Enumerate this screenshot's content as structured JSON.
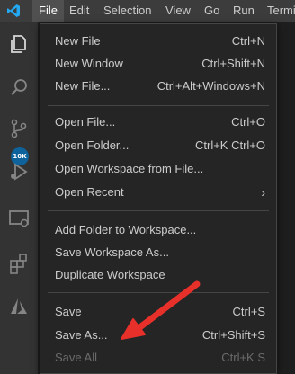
{
  "menubar": {
    "items": [
      "File",
      "Edit",
      "Selection",
      "View",
      "Go",
      "Run",
      "Termi"
    ]
  },
  "activity": {
    "badge": "10K"
  },
  "menu": {
    "groups": [
      [
        {
          "label": "New File",
          "shortcut": "Ctrl+N"
        },
        {
          "label": "New Window",
          "shortcut": "Ctrl+Shift+N"
        },
        {
          "label": "New File...",
          "shortcut": "Ctrl+Alt+Windows+N"
        }
      ],
      [
        {
          "label": "Open File...",
          "shortcut": "Ctrl+O"
        },
        {
          "label": "Open Folder...",
          "shortcut": "Ctrl+K Ctrl+O"
        },
        {
          "label": "Open Workspace from File...",
          "shortcut": ""
        },
        {
          "label": "Open Recent",
          "shortcut": ""
        }
      ],
      [
        {
          "label": "Add Folder to Workspace...",
          "shortcut": ""
        },
        {
          "label": "Save Workspace As...",
          "shortcut": ""
        },
        {
          "label": "Duplicate Workspace",
          "shortcut": ""
        }
      ],
      [
        {
          "label": "Save",
          "shortcut": "Ctrl+S"
        },
        {
          "label": "Save As...",
          "shortcut": "Ctrl+Shift+S"
        },
        {
          "label": "Save All",
          "shortcut": "Ctrl+K S"
        }
      ]
    ]
  },
  "annotation": {
    "arrow_color": "#e8302a"
  }
}
